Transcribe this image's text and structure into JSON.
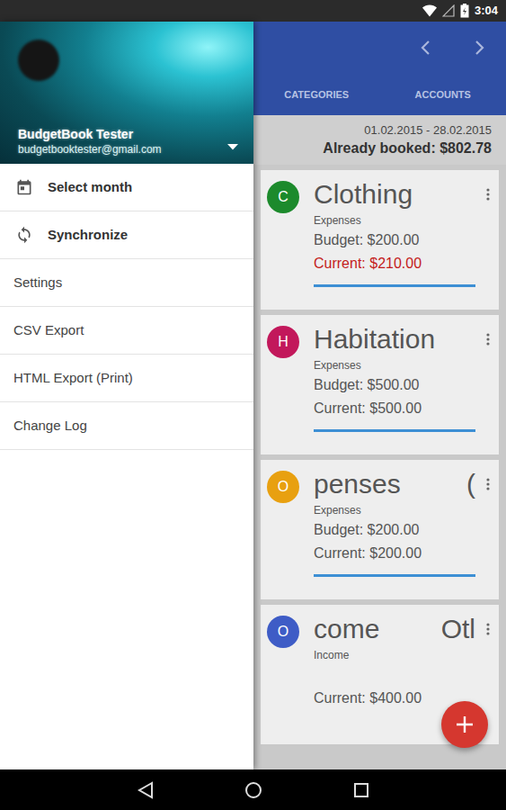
{
  "status_bar": {
    "time": "3:04"
  },
  "drawer": {
    "account": {
      "name": "BudgetBook Tester",
      "email": "budgetbooktester@gmail.com"
    },
    "items": [
      {
        "label": "Select month",
        "kind": "primary"
      },
      {
        "label": "Synchronize",
        "kind": "primary"
      },
      {
        "label": "Settings",
        "kind": "plain"
      },
      {
        "label": "CSV Export",
        "kind": "plain"
      },
      {
        "label": "HTML Export (Print)",
        "kind": "plain"
      },
      {
        "label": "Change Log",
        "kind": "plain"
      }
    ]
  },
  "toolbar": {
    "tabs": [
      {
        "label": "CATEGORIES"
      },
      {
        "label": "ACCOUNTS"
      }
    ]
  },
  "period": {
    "range": "01.02.2015 - 28.02.2015",
    "booked": "Already booked: $802.78"
  },
  "categories": [
    {
      "letter": "C",
      "color": "#1c8a2c",
      "title": "Clothing",
      "type": "Expenses",
      "budget": "Budget: $200.00",
      "current": "Current: $210.00",
      "over_budget": true,
      "level": 1
    },
    {
      "letter": "H",
      "color": "#c2185b",
      "title": "Habitation",
      "type": "Expenses",
      "budget": "Budget: $500.00",
      "current": "Current: $500.00",
      "over_budget": false,
      "level": 1
    },
    {
      "letter": "O",
      "color": "#e8a010",
      "title": "penses",
      "title_tail": "(",
      "type": "Expenses",
      "budget": "Budget: $200.00",
      "current": "Current: $200.00",
      "over_budget": false,
      "level": 1
    },
    {
      "letter": "O",
      "color": "#3e5cc6",
      "title": "come",
      "title_tail": "Otl",
      "type": "Income",
      "current": "Current: $400.00",
      "over_budget": false
    }
  ]
}
